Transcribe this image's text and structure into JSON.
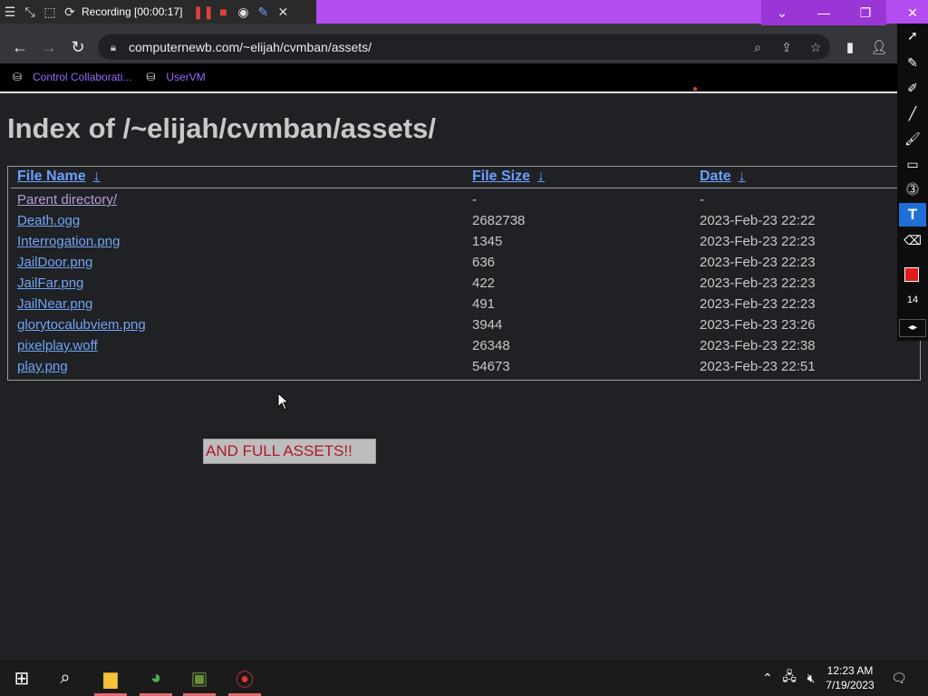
{
  "recorder": {
    "label": "Recording [00:00:17]",
    "icons": [
      "menu-icon",
      "collapse-icon",
      "region-icon",
      "rotate-icon",
      "pause-icon",
      "stop-icon",
      "camera-icon",
      "pen-icon",
      "close-icon"
    ]
  },
  "browser": {
    "url": "computernewb.com/~elijah/cvmban/assets/",
    "bookmarks": [
      {
        "label": "Control Collaborati..."
      },
      {
        "label": "UserVM"
      }
    ],
    "link_color": "#9966ff"
  },
  "page": {
    "title": "Index of /~elijah/cvmban/assets/",
    "headers": {
      "name": "File Name",
      "size": "File Size",
      "date": "Date",
      "sort_glyph": "↓"
    },
    "rows": [
      {
        "name": "Parent directory/",
        "size": "-",
        "date": "-"
      },
      {
        "name": "Death.ogg",
        "size": "2682738",
        "date": "2023-Feb-23 22:22"
      },
      {
        "name": "Interrogation.png",
        "size": "1345",
        "date": "2023-Feb-23 22:23"
      },
      {
        "name": "JailDoor.png",
        "size": "636",
        "date": "2023-Feb-23 22:23"
      },
      {
        "name": "JailFar.png",
        "size": "422",
        "date": "2023-Feb-23 22:23"
      },
      {
        "name": "JailNear.png",
        "size": "491",
        "date": "2023-Feb-23 22:23"
      },
      {
        "name": "glorytocalubviem.png",
        "size": "3944",
        "date": "2023-Feb-23 23:26"
      },
      {
        "name": "pixelplay.woff",
        "size": "26348",
        "date": "2023-Feb-23 22:38"
      },
      {
        "name": "play.png",
        "size": "54673",
        "date": "2023-Feb-23 22:51"
      }
    ],
    "assets_button": "AND FULL ASSETS!!",
    "assets_color": "#b0182a"
  },
  "palette": {
    "tools": [
      "cursor-icon",
      "pencil-icon",
      "highlighter-icon",
      "line-icon",
      "brush-icon",
      "rectangle-icon",
      "counter-icon",
      "text-icon",
      "eraser-icon"
    ],
    "active_tool": "text-icon",
    "color": "#e21b1b",
    "size": "14"
  },
  "taskbar": {
    "time": "12:23 AM",
    "date": "7/19/2023"
  }
}
